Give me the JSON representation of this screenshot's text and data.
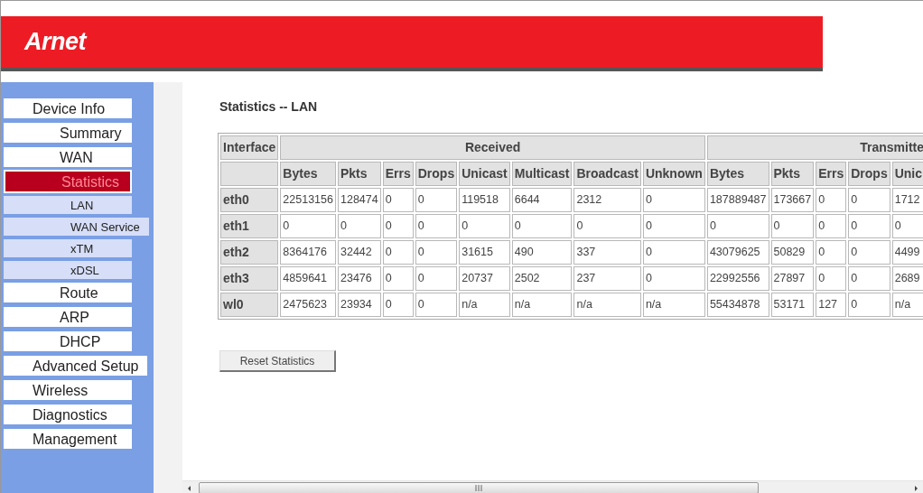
{
  "logo": {
    "text": "Arnet"
  },
  "menu": [
    {
      "label": "Device Info",
      "selected": false,
      "children": [
        {
          "label": "Summary",
          "selected": false
        },
        {
          "label": "WAN",
          "selected": false
        },
        {
          "label": "Statistics",
          "selected": true,
          "children": [
            {
              "label": "LAN",
              "selected": false
            },
            {
              "label": "WAN Service",
              "selected": false
            },
            {
              "label": "xTM",
              "selected": false
            },
            {
              "label": "xDSL",
              "selected": false
            }
          ]
        },
        {
          "label": "Route",
          "selected": false
        },
        {
          "label": "ARP",
          "selected": false
        },
        {
          "label": "DHCP",
          "selected": false
        }
      ]
    },
    {
      "label": "Advanced Setup",
      "selected": false
    },
    {
      "label": "Wireless",
      "selected": false
    },
    {
      "label": "Diagnostics",
      "selected": false
    },
    {
      "label": "Management",
      "selected": false
    }
  ],
  "page_title": "Statistics -- LAN",
  "table": {
    "interface_header": "Interface",
    "groups": [
      {
        "label": "Received",
        "columns": [
          "Bytes",
          "Pkts",
          "Errs",
          "Drops",
          "Unicast",
          "Multicast",
          "Broadcast",
          "Unknown"
        ]
      },
      {
        "label": "Transmitte",
        "columns": [
          "Bytes",
          "Pkts",
          "Errs",
          "Drops",
          "Unic"
        ]
      }
    ],
    "rows": [
      {
        "interface": "eth0",
        "cells": [
          "22513156",
          "128474",
          "0",
          "0",
          "119518",
          "6644",
          "2312",
          "0",
          "187889487",
          "173667",
          "0",
          "0",
          "1712"
        ]
      },
      {
        "interface": "eth1",
        "cells": [
          "0",
          "0",
          "0",
          "0",
          "0",
          "0",
          "0",
          "0",
          "0",
          "0",
          "0",
          "0",
          "0"
        ]
      },
      {
        "interface": "eth2",
        "cells": [
          "8364176",
          "32442",
          "0",
          "0",
          "31615",
          "490",
          "337",
          "0",
          "43079625",
          "50829",
          "0",
          "0",
          "4499"
        ]
      },
      {
        "interface": "eth3",
        "cells": [
          "4859641",
          "23476",
          "0",
          "0",
          "20737",
          "2502",
          "237",
          "0",
          "22992556",
          "27897",
          "0",
          "0",
          "2689"
        ]
      },
      {
        "interface": "wl0",
        "cells": [
          "2475623",
          "23934",
          "0",
          "0",
          "n/a",
          "n/a",
          "n/a",
          "n/a",
          "55434878",
          "53171",
          "127",
          "0",
          "n/a"
        ]
      }
    ]
  },
  "reset_button": "Reset Statistics"
}
